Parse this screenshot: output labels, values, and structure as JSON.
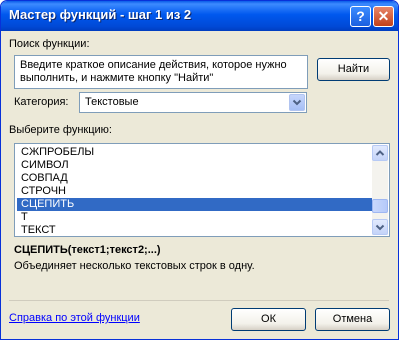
{
  "window": {
    "title": "Мастер функций - шаг 1 из 2",
    "help_label": "?",
    "close_label": "✕"
  },
  "search": {
    "label": "Поиск функции:",
    "description": [
      "Введите краткое описание действия, которое нужно",
      "выполнить, и нажмите кнопку \"Найти\""
    ],
    "find_button": "Найти"
  },
  "category": {
    "label": "Категория:",
    "value": "Текстовые"
  },
  "functions": {
    "label": "Выберите функцию:",
    "items": [
      "СЖПРОБЕЛЫ",
      "СИМВОЛ",
      "СОВПАД",
      "СТРОЧН",
      "СЦЕПИТЬ",
      "Т",
      "ТЕКСТ"
    ],
    "selected_index": 4
  },
  "selected_function": {
    "signature": "СЦЕПИТЬ(текст1;текст2;...)",
    "description": "Объединяет несколько текстовых строк в одну."
  },
  "footer": {
    "help_link": "Справка по этой функции",
    "ok_button": "ОК",
    "cancel_button": "Отмена"
  },
  "colors": {
    "title_bar": "#0058EE",
    "selection": "#316AC5",
    "dialog_bg": "#ECE9D8",
    "link": "#0000FF"
  }
}
